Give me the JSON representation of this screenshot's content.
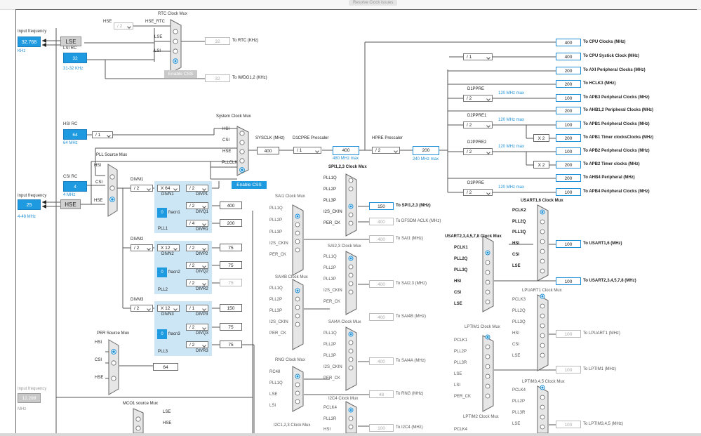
{
  "toolbar": {
    "resolve_label": "Resolve Clock Issues"
  },
  "inputs": {
    "lse": {
      "title": "Input frequency",
      "value": "32.768",
      "unit": "KHz",
      "name": "LSE"
    },
    "lsi": {
      "title": "LSI RC",
      "value": "32",
      "range": "31-32 KHz"
    },
    "hsi": {
      "title": "HSI RC",
      "value": "64",
      "unit": "64 MHz",
      "div": "/ 1"
    },
    "csi": {
      "title": "CSI RC",
      "value": "4",
      "unit": "4 MHz"
    },
    "hse": {
      "title": "Input frequency",
      "value": "25",
      "range": "4-48 MHz",
      "name": "HSE"
    },
    "ext": {
      "title": "Input frequency",
      "value": "12.288",
      "unit": "MHz"
    }
  },
  "rtc": {
    "mux_title": "RTC Clock Mux",
    "hse_label": "HSE",
    "hse_rtc": "HSE_RTC",
    "div": "/ 2",
    "lse": "LSE",
    "lsi": "LSI",
    "out_value": "32",
    "out_label": "To RTC (KHz)",
    "css_label": "Enable CSS",
    "iwdg_value": "32",
    "iwdg_label": "To IWDG1,2 (KHz)"
  },
  "sysclk": {
    "mux_title": "System Clock Mux",
    "inputs": [
      "HSI",
      "CSI",
      "HSE",
      "PLLCLK"
    ],
    "css_label": "Enable CSS",
    "label": "SYSCLK (MHz)",
    "value": "400",
    "d1cpre_label": "D1CPRE Prescaler",
    "d1cpre": "/ 1",
    "d1cpre_out": "400",
    "d1cpre_max": "480 MHz max",
    "hpre_label": "HPRE Prescaler",
    "hpre": "/ 2",
    "hpre_out": "200",
    "hpre_max": "240 MHz max"
  },
  "bus_outputs": [
    {
      "value": "400",
      "label": "To CPU Clocks (MHz)"
    },
    {
      "value": "400",
      "label": "To CPU Systick Clock (MHz)"
    },
    {
      "value": "200",
      "label": "To AXI Peripheral Clocks (MHz)"
    },
    {
      "value": "200",
      "label": "To HCLK3 (MHz)"
    },
    {
      "value": "100",
      "label": "To APB3 Peripheral Clocks (MHz)"
    },
    {
      "value": "200",
      "label": "To AHB1,2 Peripheral Clocks (MHz)"
    },
    {
      "value": "100",
      "label": "To APB1 Peripheral Clocks (MHz)"
    },
    {
      "value": "200",
      "label": "To APB1 Timer clocksClocks (MHz)"
    },
    {
      "value": "100",
      "label": "To APB2 Peripheral Clocks (MHz)"
    },
    {
      "value": "200",
      "label": "To APB2 Timer clocks (MHz)"
    },
    {
      "value": "200",
      "label": "To AHB4 Peripheral (MHz)"
    },
    {
      "value": "100",
      "label": "To APB4 Peripheral Clocks (MHz)"
    }
  ],
  "prescalers": {
    "systick": "/ 1",
    "d1ppre": {
      "label": "D1PPRE",
      "value": "/ 2",
      "max": "120 MHz max"
    },
    "d2ppre1": {
      "label": "D2PPRE1",
      "value": "/ 2",
      "max": "120 MHz max",
      "mult": "X 2"
    },
    "d2ppre2": {
      "label": "D2PPRE2",
      "value": "/ 2",
      "max": "120 MHz max",
      "mult": "X 2"
    },
    "d3ppre": {
      "label": "D3PPRE",
      "value": "/ 2",
      "max": "120 MHz max"
    }
  },
  "pll": {
    "mux_title": "PLL Source Mux",
    "inputs": [
      "HSI",
      "CSI",
      "HSE"
    ],
    "pll1": {
      "divm_label": "DIVM1",
      "divm": "/ 2",
      "divn": "X 64",
      "divn_label": "DIVN1",
      "divp": "/ 2",
      "divp_label": "DIVP1",
      "divq": "/ 2",
      "divq_label": "DIVQ1",
      "divr": "/ 4",
      "divr_label": "DIVR1",
      "frac": "0",
      "frac_label": "fracn1",
      "name": "PLL1",
      "q_out": "400",
      "r_out": "200"
    },
    "pll2": {
      "divm_label": "DIVM2",
      "divm": "/ 2",
      "divn": "X 12",
      "divn_label": "DIVN2",
      "divp": "/ 2",
      "divp_label": "DIVP2",
      "divq": "/ 2",
      "divq_label": "DIVQ2",
      "divr": "/ 2",
      "divr_label": "DIVR2",
      "frac": "0",
      "frac_label": "fracn2",
      "name": "PLL2",
      "p_out": "75",
      "q_out": "75",
      "r_out": "75"
    },
    "pll3": {
      "divm_label": "DIVM3",
      "divm": "/ 2",
      "divn": "X 12",
      "divn_label": "DIVN3",
      "divp": "/ 1",
      "divp_label": "DIVP3",
      "divq": "/ 2",
      "divq_label": "DIVQ3",
      "divr": "/ 2",
      "divr_label": "DIVR3",
      "frac": "0",
      "frac_label": "fracn3",
      "name": "PLL3",
      "p_out": "150",
      "q_out": "75",
      "r_out": "75"
    }
  },
  "per": {
    "mux_title": "PER Source Mux",
    "inputs": [
      "HSI",
      "CSI",
      "HSE"
    ],
    "out": "64"
  },
  "mco1": {
    "title": "MCO1 source Mux",
    "inputs": [
      "LSE",
      "HSE"
    ]
  },
  "spi123": {
    "title": "SPI1,2,3 Clock Mux",
    "inputs": [
      "PLL1Q",
      "PLL2P",
      "PLL3P",
      "I2S_CKIN",
      "PER_CK"
    ],
    "value": "150",
    "label": "To SPI1,2,3 (MHz)",
    "dfsdm_value": "400",
    "dfsdm_label": "To DFSDM ACLK (MHz)"
  },
  "sai1": {
    "title": "SAI1 Clock Mux",
    "inputs": [
      "PLL1Q",
      "PLL2P",
      "PLL3P",
      "I2S_CKIN",
      "PER_CK"
    ],
    "value": "400",
    "label": "To SAI1 (MHz)"
  },
  "sai23": {
    "title": "SAI2,3 Clock Mux",
    "inputs": [
      "PLL1Q",
      "PLL2P",
      "PLL3P",
      "I2S_CKIN",
      "PER_CK"
    ],
    "value": "400",
    "label": "To SAI2,3 (MHz)"
  },
  "sai4b": {
    "title": "SAI4B Clock Mux",
    "inputs": [
      "PLL1Q",
      "PLL2P",
      "PLL3P",
      "I2S_CKIN",
      "PER_CK"
    ],
    "value": "400",
    "label": "To SAI4B (MHz)"
  },
  "sai4a": {
    "title": "SAI4A Clock Mux",
    "inputs": [
      "PLL1Q",
      "PLL2P",
      "PLL3P",
      "I2S_CKIN",
      "PER_CK"
    ],
    "value": "400",
    "label": "To SAI4A (MHz)"
  },
  "rng": {
    "title": "RNG Clock Mux",
    "inputs": [
      "RC48",
      "PLL1Q",
      "LSE",
      "LSI"
    ],
    "value": "48",
    "label": "To RNG (MHz)"
  },
  "i2c4": {
    "title": "I2C4 Clock Mux",
    "inputs": [
      "PCLK4",
      "PLL3R",
      "HSI"
    ],
    "value": "100",
    "label": "To I2C4 (MHz)"
  },
  "i2c123": {
    "title": "I2C1,2,3 Clock Mux"
  },
  "usart16": {
    "title": "USART1,6 Clock Mux",
    "inputs": [
      "PCLK2",
      "PLL2Q",
      "PLL3Q",
      "HSI",
      "CSI",
      "LSE"
    ],
    "value": "100",
    "label": "To USART1,6 (MHz)"
  },
  "usart2": {
    "title": "USART2,3,4,5,7,8 Clock Mux",
    "inputs": [
      "PCLK1",
      "PLL2Q",
      "PLL3Q",
      "HSI",
      "CSI",
      "LSE"
    ],
    "value": "100",
    "label": "To USART2,3,4,5,7,8 (MHz)"
  },
  "lpuart1": {
    "title": "LPUART1 Clock Mux",
    "inputs": [
      "PCLK3",
      "PLL2Q",
      "PLL3Q",
      "HSI",
      "CSI",
      "LSE"
    ],
    "value": "100",
    "label": "To LPUART1 (MHz)"
  },
  "lptim1": {
    "title": "LPTIM1 Clock Mux",
    "inputs": [
      "PCLK1",
      "PLL2P",
      "PLL3R",
      "LSE",
      "LSI",
      "PER_CK"
    ],
    "value": "100",
    "label": "To LPTIM1 (MHz)"
  },
  "lptim345": {
    "title": "LPTIM3,4,5 Clock Mux",
    "inputs": [
      "PCLK4",
      "PLL2P",
      "PLL3R",
      "LSE"
    ],
    "value": "100",
    "label": "To LPTIM3,4,5 (MHz)"
  },
  "lptim2": {
    "title": "LPTIM2 Clock Mux",
    "inputs": [
      "PCLK4"
    ]
  }
}
